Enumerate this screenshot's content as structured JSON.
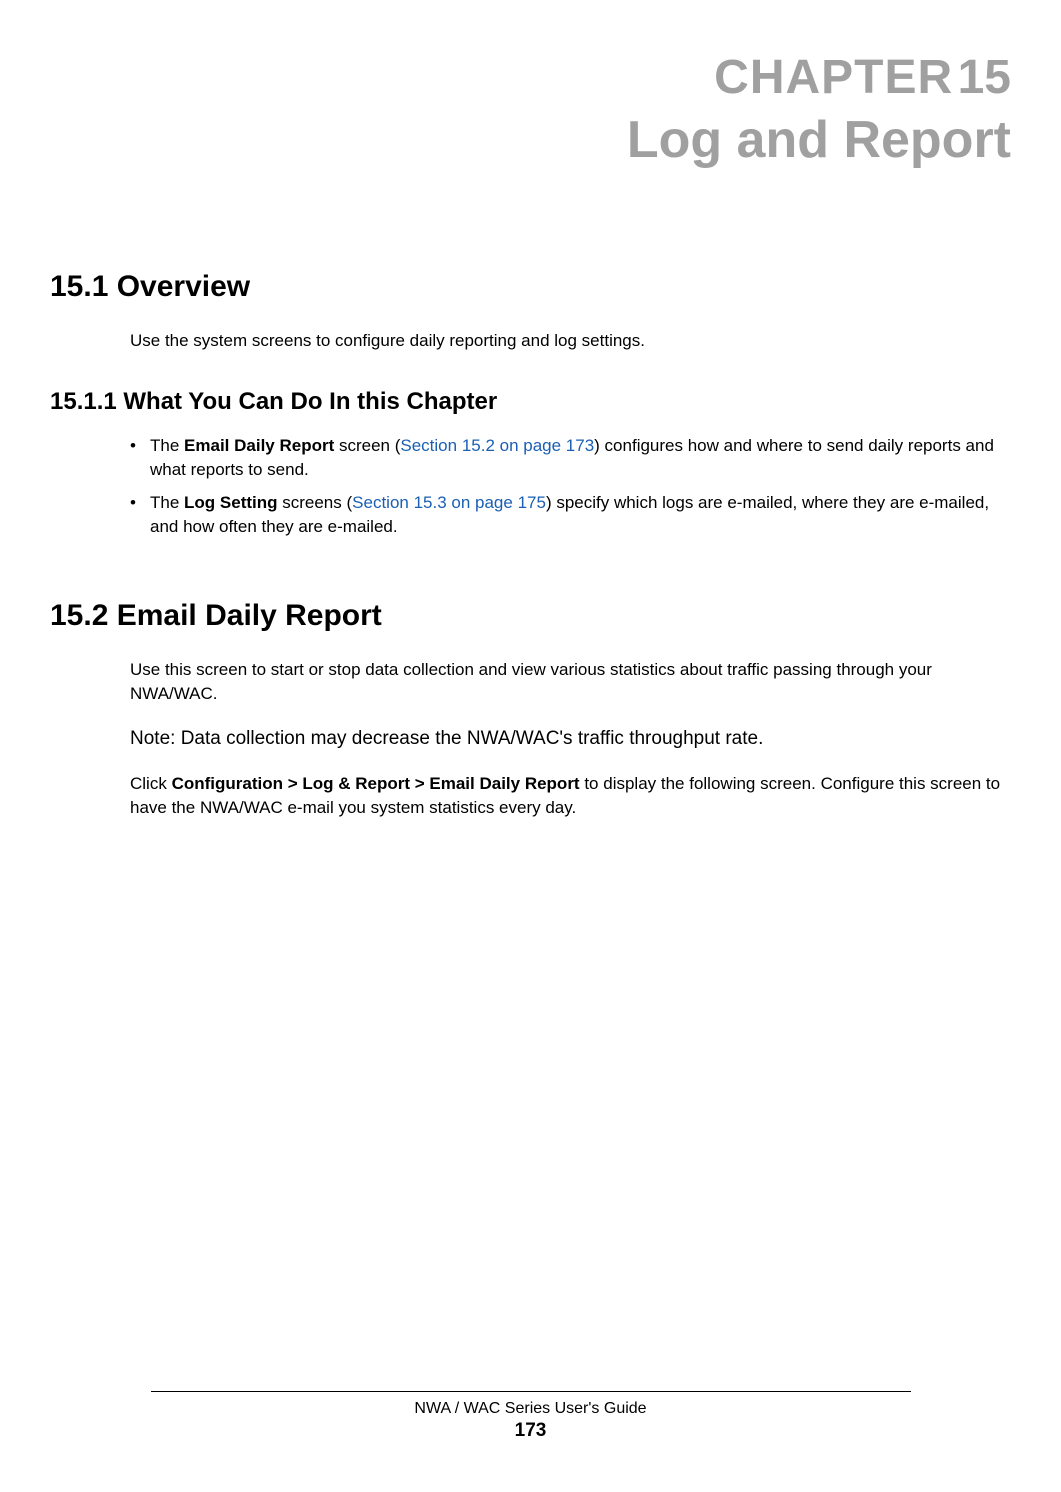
{
  "chapter": {
    "label_prefix": "C",
    "label_rest": "HAPTER",
    "number": "15",
    "title": "Log and Report"
  },
  "sections": {
    "s15_1": {
      "heading": "15.1  Overview",
      "body1": "Use the system screens to configure daily reporting and log settings."
    },
    "s15_1_1": {
      "heading": "15.1.1  What You Can Do In this Chapter",
      "bullet1_pre": "The ",
      "bullet1_bold": "Email Daily Report",
      "bullet1_mid1": " screen (",
      "bullet1_link": "Section 15.2 on page 173",
      "bullet1_post": ") configures how and where to send daily reports and what reports to send.",
      "bullet2_pre": "The ",
      "bullet2_bold": "Log Setting",
      "bullet2_mid1": " screens (",
      "bullet2_link": "Section 15.3 on page 175",
      "bullet2_post": ") specify which logs are e-mailed, where they are e-mailed, and how often they are e-mailed."
    },
    "s15_2": {
      "heading": "15.2  Email Daily Report",
      "body1": "Use this screen to start or stop data collection and view various statistics about traffic passing through your NWA/WAC.",
      "note": "Note: Data collection may decrease the NWA/WAC's traffic throughput rate.",
      "body2_pre": "Click ",
      "body2_bold": "Configuration > Log & Report > Email Daily Report",
      "body2_post": " to display the following screen. Configure this screen to have the NWA/WAC e-mail you system statistics every day."
    }
  },
  "footer": {
    "title": "NWA / WAC Series User's Guide",
    "page": "173"
  }
}
